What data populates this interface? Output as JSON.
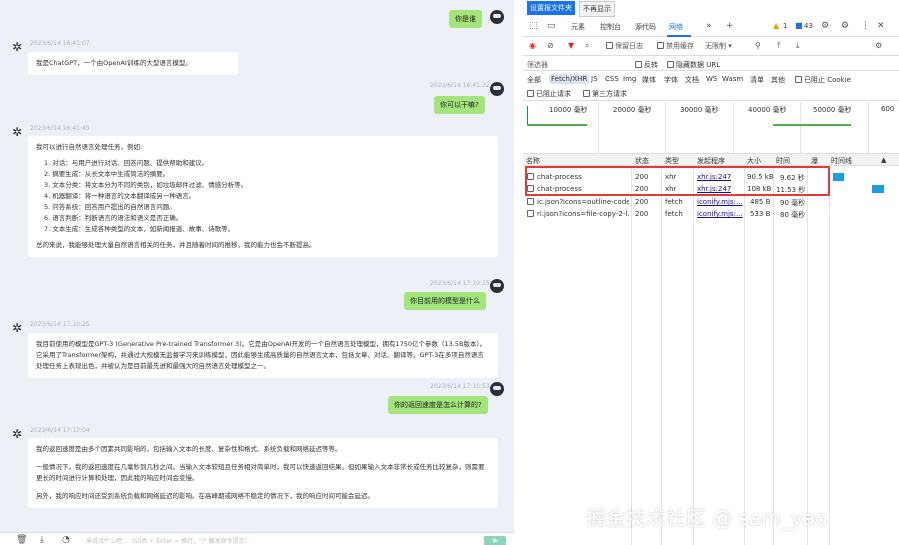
{
  "chat": {
    "messages": [
      {
        "role": "user",
        "text": "你是谁"
      },
      {
        "role": "gpt",
        "time": "2023/6/14 16:41:07",
        "text": "我是ChatGPT，一个由OpenAI训练的大型语言模型。"
      },
      {
        "role": "user",
        "time": "2023/6/14 16:41:32",
        "text": "你可以干嘛?"
      },
      {
        "role": "gpt",
        "time": "2023/6/14 16:41:45",
        "intro": "我可以进行自然语言处理任务，例如:",
        "items": [
          "1. 对话：与用户进行对话、回答问题、提供帮助和建议。",
          "2. 摘要生成：从长文本中生成简洁的摘要。",
          "3. 文本分类：将文本分为不同的类别，如垃圾邮件过滤、情感分析等。",
          "4. 机器翻译：将一种语言的文本翻译成另一种语言。",
          "5. 问答系统：回答用户提出的自然语言问题。",
          "6. 语言判断：判断语言的语法和语义是否正确。",
          "7. 文本生成：生成各种类型的文本，如新闻报道、故事、诗歌等。"
        ],
        "outro": "总的来说，我能够处理大量自然语言相关的任务，并且随着时间的推移，我的能力也会不断提高。"
      },
      {
        "role": "user",
        "time": "2023/6/14 17:10:15",
        "text": "你目前用的模型是什么"
      },
      {
        "role": "gpt",
        "time": "2023/6/14 17:10:25",
        "text": "我目前使用的模型是GPT-3 (Generative Pre-trained Transformer 3)。它是由OpenAI开发的一个自然语言处理模型，拥有1750亿个参数（13.5B版本）。它采用了Transformer架构，并通过大规模无监督学习来训练模型，因此能够生成高质量的自然语言文本，包括文章、对话、翻译等。GPT-3在多项自然语言处理任务上表现出色，并被认为是目前最先进和最强大的自然语言处理模型之一。"
      },
      {
        "role": "user",
        "time": "2023/6/14 17:10:53",
        "text": "你的返回速度是怎么计算的?"
      },
      {
        "role": "gpt",
        "time": "2023/6/14 17:13:04",
        "p1": "我的返回速度是由多个因素共同影响的，包括输入文本的长度、复杂性和格式、系统负载和网络延迟等等。",
        "p2": "一般情况下，我的返回速度在几毫秒到几秒之间。当输入文本较短且任务相对简单时，我可以快速返回结果。但如果输入文本非常长或任务比较复杂，则需要更长的时间进行计算和处理，因此我的响应时间会变慢。",
        "p3": "另外，我的响应时间还受到系统负载和网络延迟的影响。在高峰期或网络不稳定的情况下，我的响应时间可能会延迟。"
      }
    ],
    "input_placeholder": "来说点什么吧...（Shift + Enter = 换行，\"/\" 触发命令提示）"
  },
  "devtools": {
    "notice": {
      "set_folder": "设置报文件夹",
      "dont_show": "不再显示"
    },
    "tabs": [
      "元素",
      "控制台",
      "源代码",
      "网络"
    ],
    "active_tab": "网络",
    "warn_count": "1",
    "info_count": "43",
    "toolbar": {
      "preserve_log": "保留日志",
      "disable_cache": "禁用缓存",
      "throttle": "无限制"
    },
    "filter": {
      "placeholder": "筛选器",
      "invert": "反转",
      "hide_data_urls": "隐藏数据 URL"
    },
    "types": [
      "全部",
      "Fetch/XHR",
      "JS",
      "CSS",
      "Img",
      "媒体",
      "字体",
      "文档",
      "WS",
      "Wasm",
      "清单",
      "其他"
    ],
    "blocked_cookies": "已阻止 Cookie",
    "blocked_requests": "已阻止请求",
    "third_party": "第三方请求",
    "timeline_labels": [
      "10000 毫秒",
      "20000 毫秒",
      "30000 毫秒",
      "40000 毫秒",
      "50000 毫秒",
      "600"
    ],
    "columns": [
      "名称",
      "状态",
      "类型",
      "发起程序",
      "大小",
      "时间",
      "瀑",
      "时间线"
    ],
    "rows": [
      {
        "name": "chat-process",
        "status": "200",
        "type": "xhr",
        "initiator": "xhr.js:247",
        "size": "90.5 kB",
        "time": "9.62 秒"
      },
      {
        "name": "chat-process",
        "status": "200",
        "type": "xhr",
        "initiator": "xhr.js:247",
        "size": "108 kB",
        "time": "11.53 秒"
      },
      {
        "name": "ic.json?icons=outline-code",
        "status": "200",
        "type": "fetch",
        "initiator": "iconify.mjs:...",
        "size": "485 B",
        "time": "90 毫秒"
      },
      {
        "name": "ri.json?icons=file-copy-2-l...",
        "status": "200",
        "type": "fetch",
        "initiator": "iconify.mjs:...",
        "size": "533 B",
        "time": "80 毫秒"
      }
    ]
  },
  "watermark": "掘金技术社区 @ sam_yao"
}
